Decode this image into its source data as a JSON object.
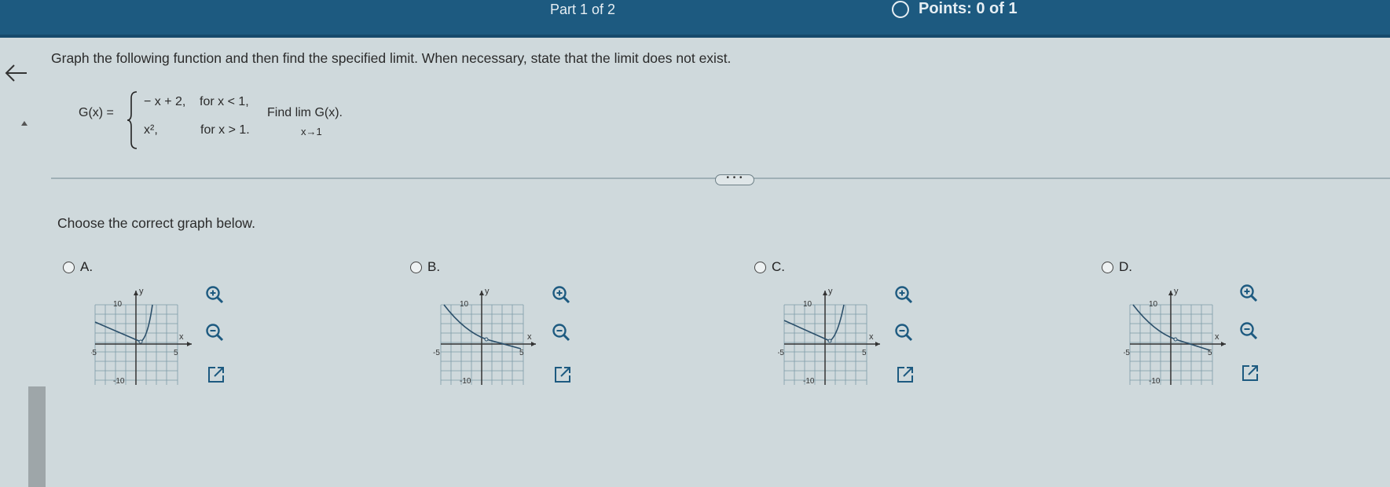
{
  "header": {
    "part": "Part 1 of 2",
    "points": "Points: 0 of 1"
  },
  "question": {
    "prompt": "Graph the following function and then find the specified limit. When necessary, state that the limit does not exist.",
    "func_name": "G(x) =",
    "case1_expr": "− x + 2,",
    "case1_cond": "for x < 1,",
    "case2_expr": "x²,",
    "case2_cond": "for x > 1.",
    "find": "Find lim G(x).",
    "lim_sub": "x→1"
  },
  "more_button": "• • •",
  "choose_prompt": "Choose the correct graph below.",
  "options": [
    {
      "letter": "A.",
      "y_label": "y",
      "x_label": "x",
      "ymax": "10",
      "ymin": "-10",
      "xmin": "-5",
      "xmax": "5"
    },
    {
      "letter": "B.",
      "y_label": "y",
      "x_label": "x",
      "ymax": "10",
      "ymin": "-10",
      "xmin": "-5",
      "xmax": "5"
    },
    {
      "letter": "C.",
      "y_label": "y",
      "x_label": "x",
      "ymax": "10",
      "ymin": "-10",
      "xmin": "-5",
      "xmax": "5"
    },
    {
      "letter": "D.",
      "y_label": "y",
      "x_label": "x",
      "ymax": "10",
      "ymin": "-10",
      "xmin": "-5",
      "xmax": "5"
    }
  ],
  "icons": {
    "back": "back-arrow-icon",
    "zoom_in": "zoom-in-icon",
    "zoom_out": "zoom-out-icon",
    "open": "external-link-icon"
  },
  "colors": {
    "header": "#1d5a80",
    "background": "#cfd9dc",
    "tool_blue": "#1d5a80"
  }
}
